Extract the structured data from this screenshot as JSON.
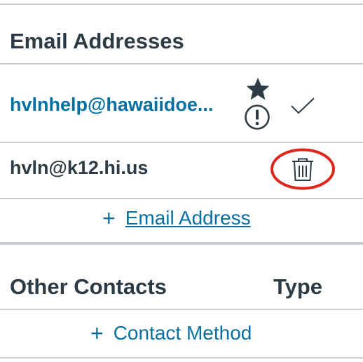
{
  "email_section": {
    "heading": "Email Addresses",
    "emails": [
      {
        "address": "hvlnhelp@hawaiidoe...",
        "is_default": true,
        "icons": [
          "star-icon",
          "alert-circle-icon",
          "checkmark-icon"
        ]
      },
      {
        "address": "hvln@k12.hi.us",
        "is_default": false,
        "icons": [
          "trash-icon"
        ],
        "annotation": {
          "shape": "circle",
          "color": "#e0261b"
        }
      }
    ],
    "add_label": "Email Address"
  },
  "contacts_section": {
    "heading": "Other Contacts",
    "type_heading": "Type",
    "add_label": "Contact Method"
  },
  "colors": {
    "text": "#2d3b45",
    "link": "#0770a3",
    "divider": "#c7cdd1",
    "annotation": "#e0261b"
  }
}
